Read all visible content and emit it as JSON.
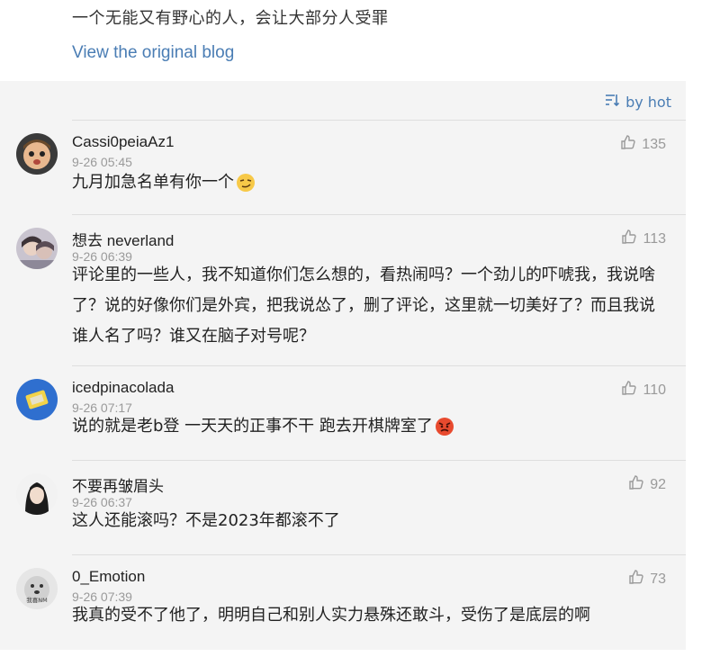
{
  "header": {
    "top_text": "一个无能又有野心的人，会让大部分人受罪",
    "blog_link": "View the original blog"
  },
  "sort": {
    "label": "by hot"
  },
  "comments": [
    {
      "user": "Cassi0peiaAz1",
      "time": "9-26 05:45",
      "likes": "135",
      "text": "九月加急名单有你一个",
      "emoji": "smirk-face-emoji"
    },
    {
      "user": "想去 neverland",
      "time": "9-26 06:39",
      "likes": "113",
      "text": "评论里的一些人，我不知道你们怎么想的，看热闹吗？一个劲儿的吓唬我，我说啥了？说的好像你们是外宾，把我说怂了，删了评论，这里就一切美好了？而且我说谁人名了吗？谁又在脑子对号呢？"
    },
    {
      "user": "icedpinacolada",
      "time": "9-26 07:17",
      "likes": "110",
      "text": "说的就是老b登 一天天的正事不干 跑去开棋牌室了",
      "emoji": "angry-face-emoji"
    },
    {
      "user": "不要再皱眉头",
      "time": "9-26 06:37",
      "likes": "92",
      "text": "这人还能滚吗？不是2023年都滚不了"
    },
    {
      "user": "0_Emotion",
      "time": "9-26 07:39",
      "likes": "73",
      "text": "我真的受不了他了，明明自己和别人实力悬殊还敢斗，受伤了是底层的啊",
      "avatar_text": "我喜NM"
    }
  ]
}
